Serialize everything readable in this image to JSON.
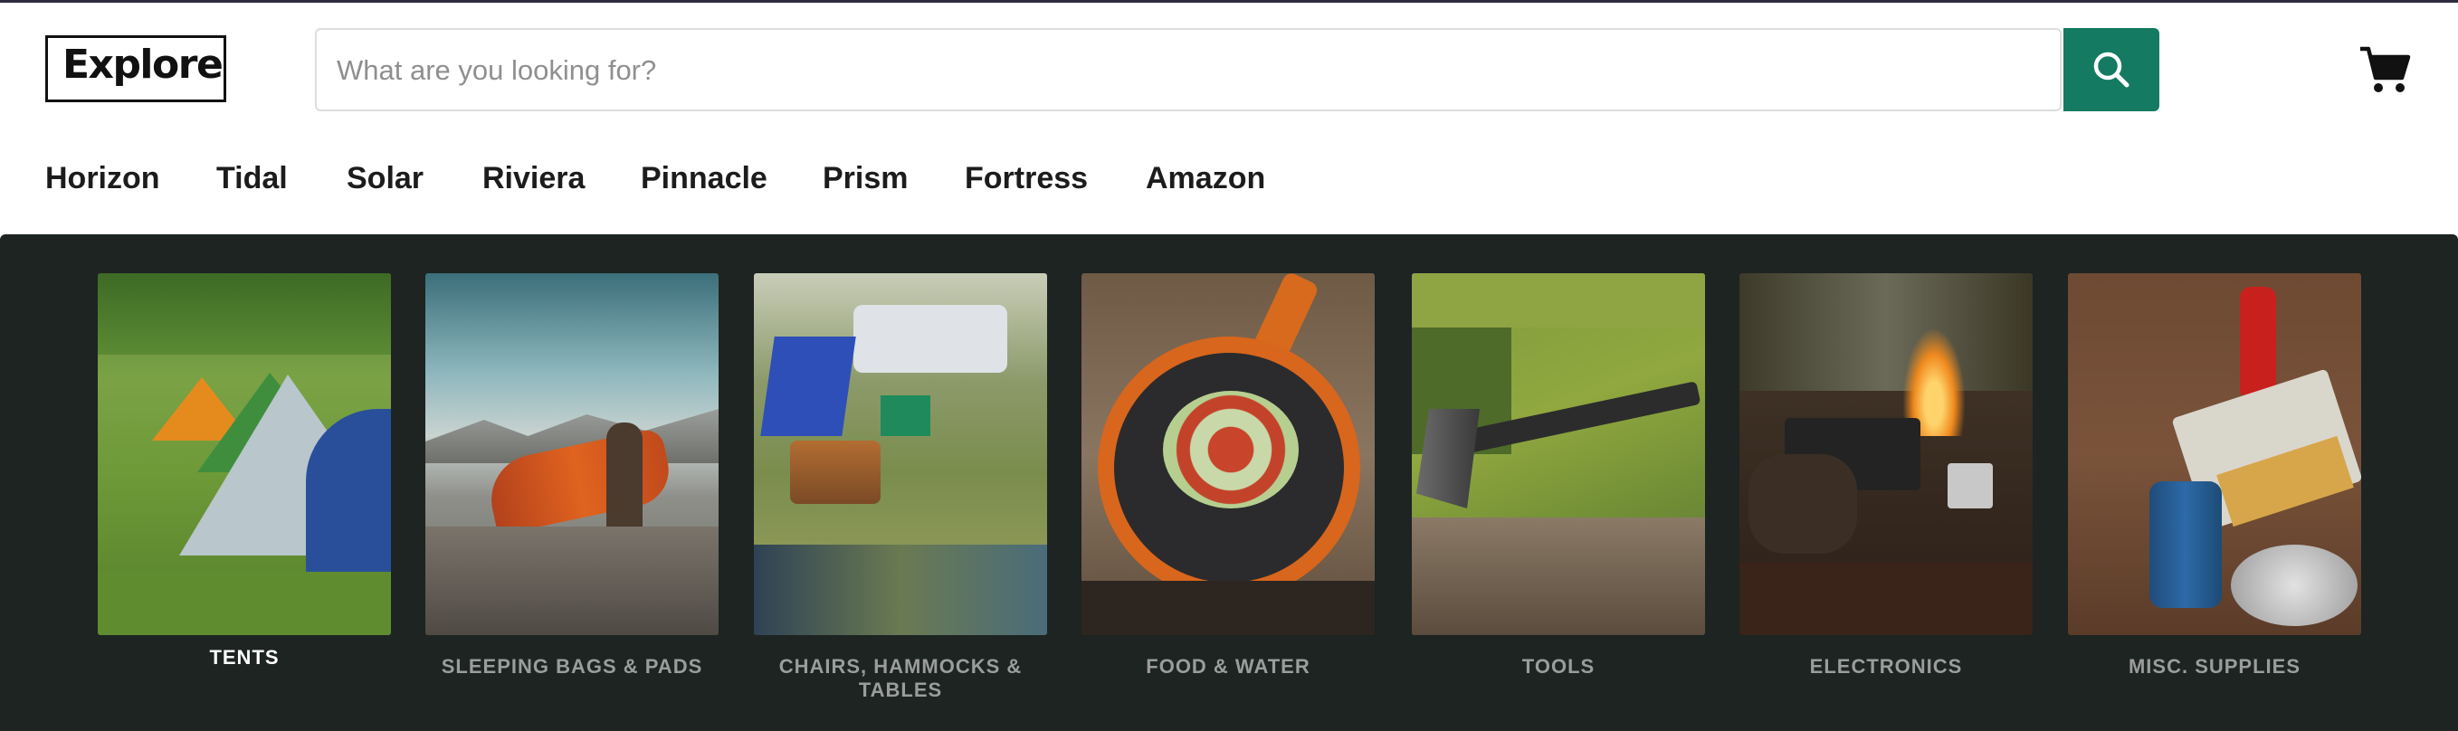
{
  "brand": {
    "logo_text": "Explore"
  },
  "search": {
    "placeholder": "What are you looking for?",
    "value": ""
  },
  "icons": {
    "search": "search-icon",
    "cart": "cart-icon"
  },
  "colors": {
    "accent": "#147a62",
    "panel": "#1d2422"
  },
  "nav": {
    "items": [
      {
        "label": "Horizon"
      },
      {
        "label": "Tidal"
      },
      {
        "label": "Solar"
      },
      {
        "label": "Riviera"
      },
      {
        "label": "Pinnacle"
      },
      {
        "label": "Prism"
      },
      {
        "label": "Fortress"
      },
      {
        "label": "Amazon"
      }
    ]
  },
  "categories": [
    {
      "label": "TENTS",
      "active": true
    },
    {
      "label": "SLEEPING BAGS & PADS",
      "active": false
    },
    {
      "label": "CHAIRS, HAMMOCKS & TABLES",
      "active": false
    },
    {
      "label": "FOOD & WATER",
      "active": false
    },
    {
      "label": "TOOLS",
      "active": false
    },
    {
      "label": "ELECTRONICS",
      "active": false
    },
    {
      "label": "MISC. SUPPLIES",
      "active": false
    }
  ]
}
